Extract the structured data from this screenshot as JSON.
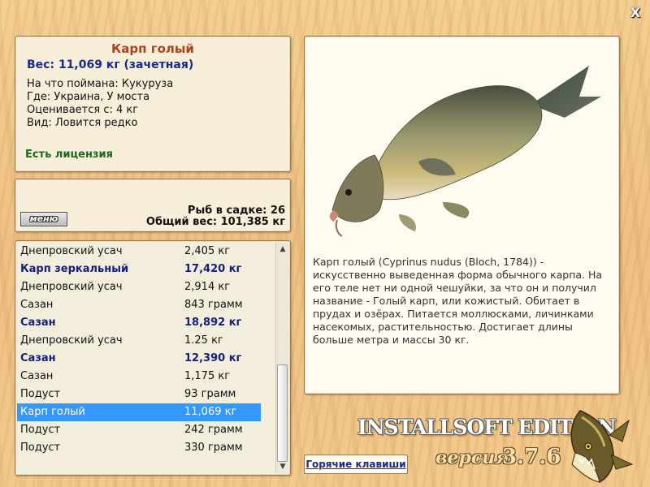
{
  "window": {
    "close_glyph": "X"
  },
  "fish": {
    "title": "Карп голый",
    "weight_line": "Вес: 11,069 кг (зачетная)",
    "caught_on": "На что поймана: Кукуруза",
    "location": "Где: Украина, У моста",
    "valued_from": "Оценивается с: 4 кг",
    "kind": "Вид: Ловится редко",
    "license": "Есть лицензия",
    "description": "Карп голый (Cyprinus nudus (Bloch, 1784)) - искусственно выведенная форма обычного карпа. На его теле нет ни одной чешуйки, за что он и получил название - Голый карп, или кожистый. Обитает в прудах и озёрах. Питается моллюсками, личинками насекомых, растительностью. Достигает длины больше метра и массы 30 кг."
  },
  "keep_net": {
    "menu_label": "меню",
    "count_line": "Рыб в садке: 26",
    "total_line": "Общий вес: 101,385 кг"
  },
  "catch_list": [
    {
      "name": "Днепровский усач",
      "weight": "2,405 кг",
      "trophy": false,
      "selected": false
    },
    {
      "name": "Карп зеркальный",
      "weight": "17,420 кг",
      "trophy": true,
      "selected": false
    },
    {
      "name": "Днепровский усач",
      "weight": "2,914 кг",
      "trophy": false,
      "selected": false
    },
    {
      "name": "Сазан",
      "weight": "843 грамм",
      "trophy": false,
      "selected": false
    },
    {
      "name": "Сазан",
      "weight": "18,892 кг",
      "trophy": true,
      "selected": false
    },
    {
      "name": "Днепровский усач",
      "weight": "1.25 кг",
      "trophy": false,
      "selected": false
    },
    {
      "name": "Сазан",
      "weight": "12,390 кг",
      "trophy": true,
      "selected": false
    },
    {
      "name": "Сазан",
      "weight": "1,175 кг",
      "trophy": false,
      "selected": false
    },
    {
      "name": "Подуст",
      "weight": "93 грамм",
      "trophy": false,
      "selected": false
    },
    {
      "name": "Карп голый",
      "weight": "11,069 кг",
      "trophy": false,
      "selected": true
    },
    {
      "name": "Подуст",
      "weight": "242 грамм",
      "trophy": false,
      "selected": false
    },
    {
      "name": "Подуст",
      "weight": "330 грамм",
      "trophy": false,
      "selected": false
    }
  ],
  "scrollbar": {
    "up_glyph": "▲",
    "down_glyph": "▼"
  },
  "footer": {
    "hotkeys_label": "Горячие клавиши",
    "edition": "INSTALLSOFT EDITION",
    "version_label": "версия",
    "version_number": "3.7.6"
  },
  "colors": {
    "selection": "#3399ff",
    "trophy_text": "#15207a",
    "title": "#b0401a",
    "license": "#1a6a1a"
  }
}
